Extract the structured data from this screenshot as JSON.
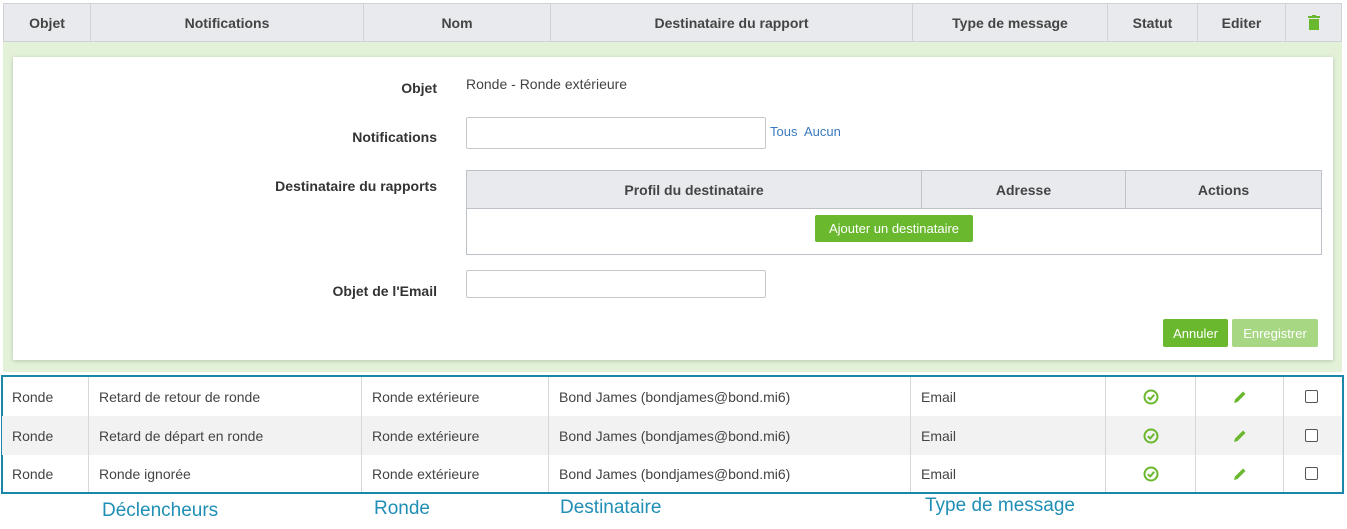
{
  "table": {
    "headers": {
      "objet": "Objet",
      "notifications": "Notifications",
      "nom": "Nom",
      "destinataire": "Destinataire du rapport",
      "type": "Type de message",
      "statut": "Statut",
      "editer": "Editer"
    },
    "rows": [
      {
        "objet": "Ronde",
        "notification": "Retard de retour de ronde",
        "nom": "Ronde extérieure",
        "destinataire": "Bond James (bondjames@bond.mi6)",
        "type": "Email"
      },
      {
        "objet": "Ronde",
        "notification": "Retard de départ en ronde",
        "nom": "Ronde extérieure",
        "destinataire": "Bond James (bondjames@bond.mi6)",
        "type": "Email"
      },
      {
        "objet": "Ronde",
        "notification": "Ronde ignorée",
        "nom": "Ronde extérieure",
        "destinataire": "Bond James (bondjames@bond.mi6)",
        "type": "Email"
      }
    ]
  },
  "edit": {
    "objet_label": "Objet",
    "objet_value": "Ronde - Ronde extérieure",
    "notifications_label": "Notifications",
    "notifications_value": "",
    "tous": "Tous",
    "aucun": "Aucun",
    "destinataire_label": "Destinataire du rapports",
    "recip_headers": {
      "profil": "Profil du destinataire",
      "adresse": "Adresse",
      "actions": "Actions"
    },
    "add_recipient": "Ajouter un destinataire",
    "email_subject_label": "Objet de l'Email",
    "email_subject_value": "",
    "cancel": "Annuler",
    "save": "Enregistrer"
  },
  "annotations": {
    "declencheurs": "Déclencheurs",
    "ronde": "Ronde",
    "destinataire": "Destinataire",
    "type_message": "Type de message"
  },
  "colors": {
    "accent_green": "#6ab82e",
    "annotation_blue": "#1f8fb5"
  }
}
